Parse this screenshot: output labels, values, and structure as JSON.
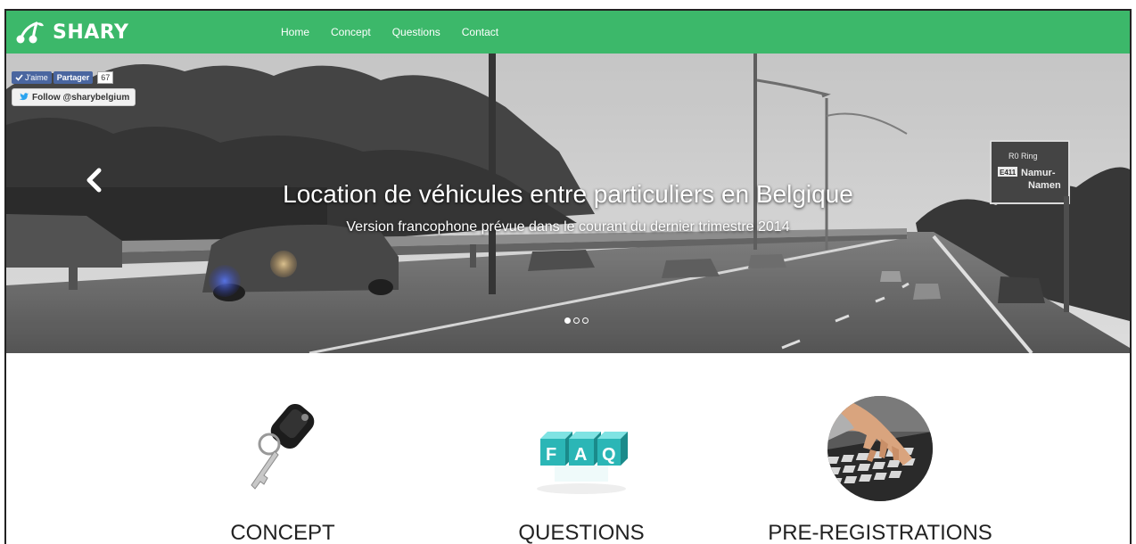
{
  "brand": {
    "name": "SHARY",
    "color": "#3cb86a"
  },
  "nav": {
    "items": [
      "Home",
      "Concept",
      "Questions",
      "Contact"
    ]
  },
  "social": {
    "like_label": "J'aime",
    "share_label": "Partager",
    "count": "67",
    "follow_label": "Follow @sharybelgium"
  },
  "hero": {
    "title": "Location de véhicules entre particuliers en Belgique",
    "subtitle": "Version francophone prévue dans le courant du dernier trimestre 2014",
    "sign_line1": "R0 Ring",
    "sign_exit": "E411",
    "sign_line2": "Namur-",
    "sign_line3": "Namen",
    "slides_total": 3,
    "active_slide": 1
  },
  "features": [
    {
      "title": "CONCEPT",
      "icon": "car-key-icon"
    },
    {
      "title": "QUESTIONS",
      "icon": "faq-blocks-icon",
      "letters": [
        "F",
        "A",
        "Q"
      ]
    },
    {
      "title": "PRE-REGISTRATIONS",
      "icon": "keyboard-hand-icon"
    }
  ]
}
